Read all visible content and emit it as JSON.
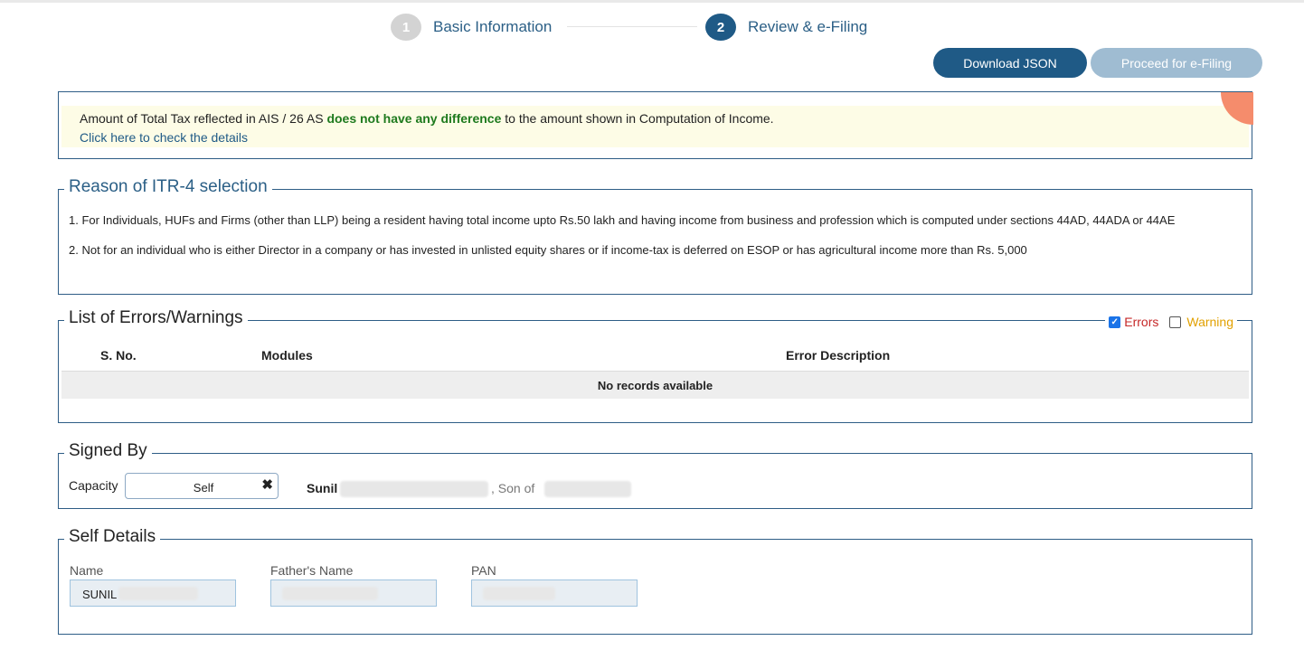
{
  "stepper": {
    "step1": {
      "number": "1",
      "label": "Basic Information"
    },
    "step2": {
      "number": "2",
      "label": "Review & e-Filing"
    }
  },
  "actions": {
    "download_json": "Download JSON",
    "proceed_efiling": "Proceed for e-Filing"
  },
  "alert": {
    "text_before": "Amount of Total Tax reflected in AIS / 26 AS ",
    "text_highlight": "does not have any difference",
    "text_after": " to the amount shown in Computation of Income.",
    "link": "Click here to check the details"
  },
  "reason": {
    "title": "Reason of ITR-4 selection",
    "items": [
      "1. For Individuals, HUFs and Firms (other than LLP) being a resident having total income upto Rs.50 lakh and having income from business and profession which is computed under sections 44AD, 44ADA or 44AE",
      "2. Not for an individual who is either Director in a company or has invested in unlisted equity shares or if income-tax is deferred on ESOP or has agricultural income more than Rs. 5,000"
    ]
  },
  "errors": {
    "title": "List of Errors/Warnings",
    "filter_errors": "Errors",
    "filter_warning": "Warning",
    "columns": [
      "S. No.",
      "Modules",
      "Error Description"
    ],
    "empty_message": "No records available"
  },
  "signed_by": {
    "title": "Signed By",
    "capacity_label": "Capacity",
    "capacity_value": "Self",
    "clear_symbol": "✖",
    "signer_first_name": "Sunil",
    "son_of_label": ",  Son of"
  },
  "self_details": {
    "title": "Self Details",
    "name_label": "Name",
    "name_value": "SUNIL",
    "father_label": "Father's Name",
    "pan_label": "PAN"
  },
  "colors": {
    "primary": "#1f5a86",
    "border": "#2e5d86",
    "highlight_green": "#1e7a1e",
    "error_red": "#c62828",
    "warning_amber": "#e2a100"
  }
}
